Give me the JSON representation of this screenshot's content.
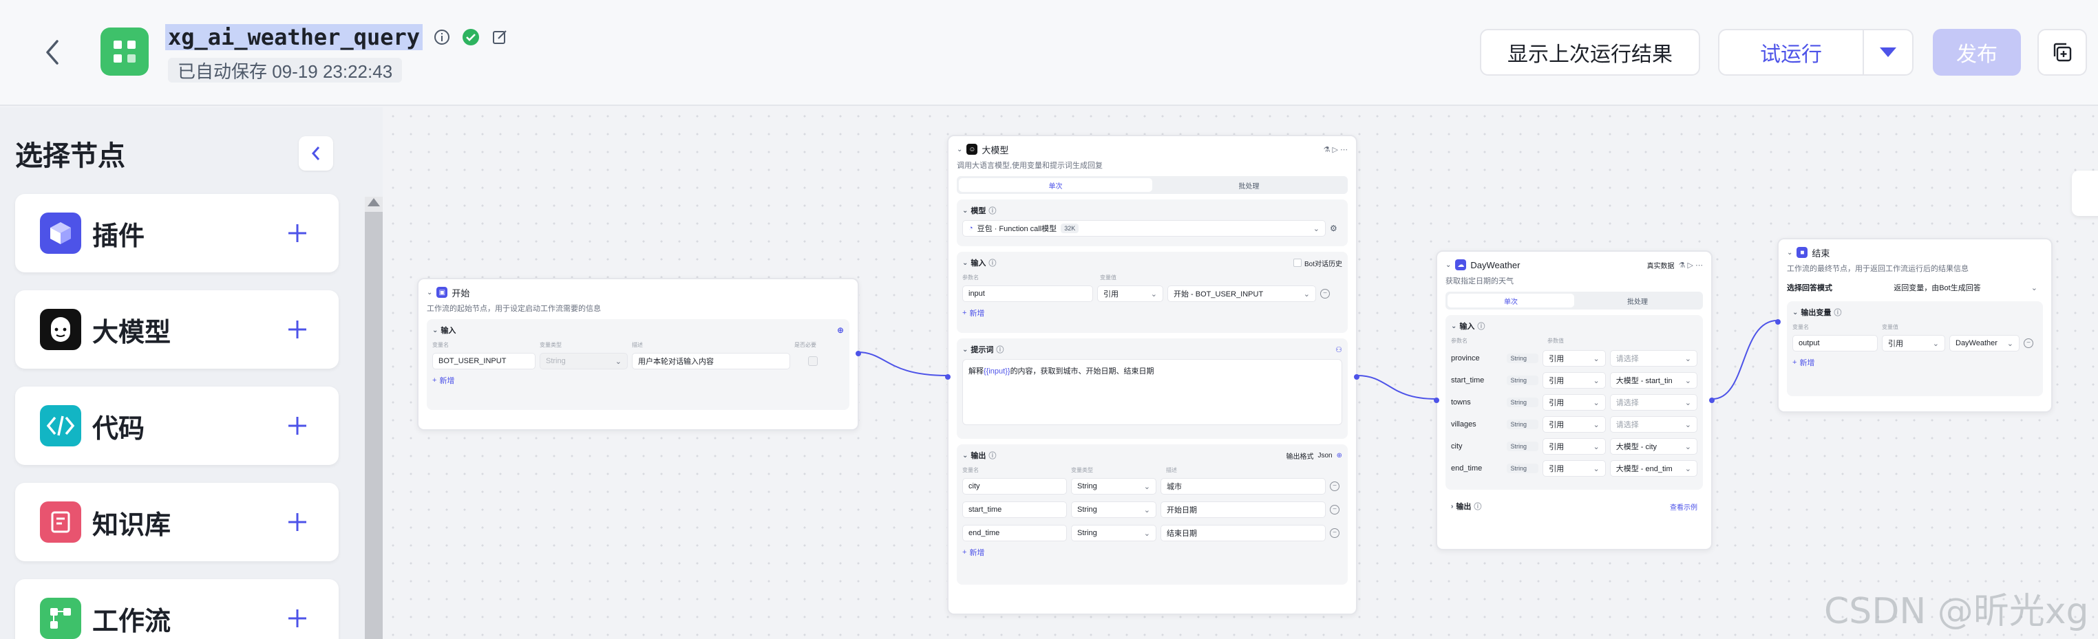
{
  "header": {
    "app_title": "xg_ai_weather_query",
    "autosave": "已自动保存 09-19 23:22:43",
    "show_last_result": "显示上次运行结果",
    "test_run": "试运行",
    "publish": "发布"
  },
  "left_panel": {
    "title": "选择节点",
    "items": [
      {
        "label": "插件",
        "icon": "plugin-cube-icon",
        "color": "#4d53e8"
      },
      {
        "label": "大模型",
        "icon": "llm-face-icon",
        "color": "#111111"
      },
      {
        "label": "代码",
        "icon": "code-icon",
        "color": "#12b5c4"
      },
      {
        "label": "知识库",
        "icon": "knowledge-book-icon",
        "color": "#e8546f"
      },
      {
        "label": "工作流",
        "icon": "workflow-icon",
        "color": "#3ec16a"
      }
    ]
  },
  "start_node": {
    "title": "开始",
    "desc": "工作流的起始节点，用于设定启动工作流需要的信息",
    "input_label": "输入",
    "cols": [
      "变量名",
      "变量类型",
      "描述",
      "是否必要"
    ],
    "row": {
      "name": "BOT_USER_INPUT",
      "type": "String",
      "desc": "用户本轮对话输入内容"
    },
    "add": "新增"
  },
  "llm_node": {
    "title": "大模型",
    "desc": "调用大语言模型,使用变量和提示词生成回复",
    "tab_single": "单次",
    "tab_batch": "批处理",
    "model_label": "模型",
    "model_value": "豆包 · Function call模型",
    "model_tag": "32K",
    "input_label": "输入",
    "bot_history": "Bot对话历史",
    "input_cols": [
      "参数名",
      "变量值"
    ],
    "input_row": {
      "name": "input",
      "mode": "引用",
      "value": "开始 - BOT_USER_INPUT"
    },
    "add": "新增",
    "prompt_label": "提示词",
    "prompt_prefix": "解释",
    "prompt_var": "{{input}}",
    "prompt_suffix": "的内容，获取到城市、开始日期、结束日期",
    "output_label": "输出",
    "output_format_label": "输出格式",
    "output_format": "Json",
    "output_cols": [
      "变量名",
      "变量类型",
      "描述"
    ],
    "outputs": [
      {
        "name": "city",
        "type": "String",
        "desc": "城市"
      },
      {
        "name": "start_time",
        "type": "String",
        "desc": "开始日期"
      },
      {
        "name": "end_time",
        "type": "String",
        "desc": "结束日期"
      }
    ]
  },
  "weather_node": {
    "title": "DayWeather",
    "data_mode": "真实数据",
    "desc": "获取指定日期的天气",
    "tab_single": "单次",
    "tab_batch": "批处理",
    "input_label": "输入",
    "cols": [
      "参数名",
      "参数值"
    ],
    "params": [
      {
        "name": "province",
        "type": "String",
        "mode": "引用",
        "value": "请选择",
        "placeholder": true
      },
      {
        "name": "start_time",
        "type": "String",
        "mode": "引用",
        "value": "大模型 - start_tin",
        "placeholder": false
      },
      {
        "name": "towns",
        "type": "String",
        "mode": "引用",
        "value": "请选择",
        "placeholder": true
      },
      {
        "name": "villages",
        "type": "String",
        "mode": "引用",
        "value": "请选择",
        "placeholder": true
      },
      {
        "name": "city",
        "type": "String",
        "mode": "引用",
        "value": "大模型 - city",
        "placeholder": false
      },
      {
        "name": "end_time",
        "type": "String",
        "mode": "引用",
        "value": "大模型 - end_tim",
        "placeholder": false
      }
    ],
    "output_label": "输出",
    "view_example": "查看示例"
  },
  "end_node": {
    "title": "结束",
    "desc": "工作流的最终节点，用于返回工作流运行后的结果信息",
    "answer_mode_label": "选择回答模式",
    "answer_mode": "返回变量，由Bot生成回答",
    "output_var_label": "输出变量",
    "cols": [
      "变量名",
      "变量值"
    ],
    "row": {
      "name": "output",
      "mode": "引用",
      "value": "DayWeather"
    },
    "add": "新增"
  },
  "watermark": "CSDN @昕光xg"
}
